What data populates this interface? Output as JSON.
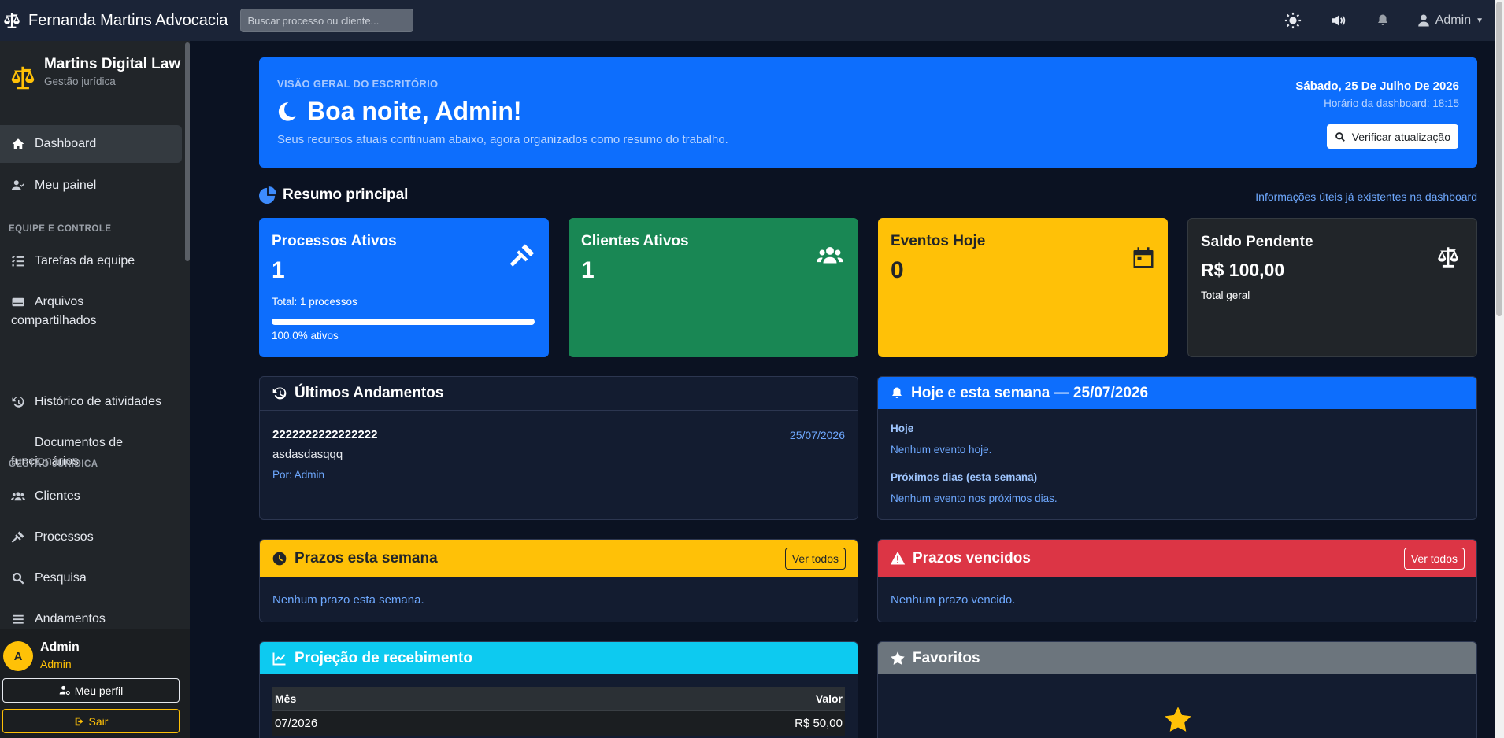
{
  "topbar": {
    "brand": "Fernanda Martins Advocacia",
    "search_placeholder": "Buscar processo ou cliente...",
    "user": "Admin"
  },
  "sidebar": {
    "brand_name": "Martins Digital Law",
    "brand_sub": "Gestão jurídica",
    "items_top": [
      {
        "label": "Dashboard",
        "icon": "home-icon"
      },
      {
        "label": "Meu painel",
        "icon": "user-check-icon"
      }
    ],
    "section_1": "EQUIPE E CONTROLE",
    "items_team": [
      {
        "label": "Tarefas da equipe",
        "icon": "list-check-icon"
      },
      {
        "label": "Arquivos compartilhados",
        "icon": "hdd-icon"
      },
      {
        "label": "Histórico de atividades",
        "icon": "history-icon"
      },
      {
        "label": "Documentos de funcionários",
        "icon": ""
      }
    ],
    "section_2": "GESTÃO JURÍDICA",
    "items_legal": [
      {
        "label": "Clientes",
        "icon": "users-icon"
      },
      {
        "label": "Processos",
        "icon": "gavel-icon"
      },
      {
        "label": "Pesquisa",
        "icon": "search-icon"
      },
      {
        "label": "Andamentos",
        "icon": "bars-icon"
      }
    ],
    "footer": {
      "avatar_letter": "A",
      "name": "Admin",
      "role": "Admin",
      "profile_button": "Meu perfil",
      "logout_button": "Sair"
    }
  },
  "hero": {
    "eyebrow": "VISÃO GERAL DO ESCRITÓRIO",
    "greeting": "Boa noite, Admin!",
    "lead": "Seus recursos atuais continuam abaixo, agora organizados como resumo do trabalho.",
    "date": "Sábado, 25 De Julho De 2026",
    "time": "Horário da dashboard: 18:15",
    "check_button": "Verificar atualização"
  },
  "summary": {
    "title": "Resumo principal",
    "link": "Informações úteis já existentes na dashboard",
    "cards": [
      {
        "label": "Processos Ativos",
        "value": "1",
        "total": "Total: 1 processos",
        "progress": 1.0,
        "progress_text": "100.0% ativos",
        "color": "#0d6efd"
      },
      {
        "label": "Clientes Ativos",
        "value": "1",
        "color": "#198754"
      },
      {
        "label": "Eventos Hoje",
        "value": "0",
        "color": "#ffc107"
      },
      {
        "label": "Saldo Pendente",
        "value": "R$ 100,00",
        "sub": "Total geral",
        "color": "#212529"
      }
    ]
  },
  "andamentos": {
    "title": "Últimos Andamentos",
    "item": {
      "number": "2222222222222222",
      "date": "25/07/2026",
      "text": "asdasdasqqq",
      "by": "Por: Admin"
    }
  },
  "semana": {
    "title": "Hoje e esta semana — 25/07/2026",
    "today_label": "Hoje",
    "today_text": "Nenhum evento hoje.",
    "next_label": "Próximos dias (esta semana)",
    "next_text": "Nenhum evento nos próximos dias."
  },
  "prazos_semana": {
    "title": "Prazos esta semana",
    "button": "Ver todos",
    "text": "Nenhum prazo esta semana."
  },
  "prazos_vencidos": {
    "title": "Prazos vencidos",
    "button": "Ver todos",
    "text": "Nenhum prazo vencido."
  },
  "projecao": {
    "title": "Projeção de recebimento",
    "col_month": "Mês",
    "col_value": "Valor",
    "rows": [
      {
        "month": "07/2026",
        "value": "R$ 50,00"
      }
    ]
  },
  "favoritos": {
    "title": "Favoritos"
  }
}
